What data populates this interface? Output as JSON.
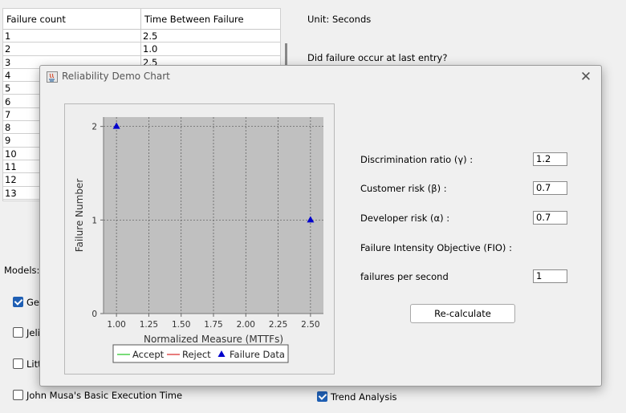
{
  "background": {
    "table": {
      "headers": [
        "Failure count",
        "Time Between Failure"
      ],
      "rows": [
        [
          "1",
          "2.5"
        ],
        [
          "2",
          "1.0"
        ],
        [
          "3",
          "2.5"
        ],
        [
          "4",
          ""
        ],
        [
          "5",
          ""
        ],
        [
          "6",
          ""
        ],
        [
          "7",
          ""
        ],
        [
          "8",
          ""
        ],
        [
          "9",
          ""
        ],
        [
          "10",
          ""
        ],
        [
          "11",
          ""
        ],
        [
          "12",
          ""
        ],
        [
          "13",
          ""
        ]
      ]
    },
    "unit_label": "Unit: Seconds",
    "question_label": "Did failure occur at last entry?",
    "models_label": "Models:",
    "models": [
      {
        "label": "Geo",
        "checked": true
      },
      {
        "label": "Jeli",
        "checked": false
      },
      {
        "label": "Litt",
        "checked": false
      },
      {
        "label": "John Musa's Basic Execution Time",
        "checked": false
      }
    ],
    "trend": {
      "label": "Trend Analysis",
      "checked": true
    }
  },
  "dialog": {
    "title": "Reliability Demo Chart",
    "close_icon": "close-icon",
    "params": {
      "disc_label": "Discrimination ratio (γ) :",
      "disc_value": "1.2",
      "cust_label": "Customer risk (β) :",
      "cust_value": "0.7",
      "dev_label": "Developer risk (α) :",
      "dev_value": "0.7",
      "fio_label": "Failure Intensity Objective (FIO) :",
      "fps_label": "failures per second",
      "fps_value": "1"
    },
    "recalc_label": "Re-calculate"
  },
  "chart_data": {
    "type": "scatter",
    "title": "",
    "xlabel": "Normalized Measure (MTTFs)",
    "ylabel": "Failure Number",
    "xlim": [
      0.9,
      2.6
    ],
    "ylim": [
      0,
      2.1
    ],
    "xticks": [
      "1.00",
      "1.25",
      "1.50",
      "1.75",
      "2.00",
      "2.25",
      "2.50"
    ],
    "yticks": [
      "0",
      "1",
      "2"
    ],
    "grid": true,
    "background": "#c0c0c0",
    "legend_position": "bottom",
    "series": [
      {
        "name": "Accept",
        "type": "line",
        "color": "#4cd04c",
        "values": []
      },
      {
        "name": "Reject",
        "type": "line",
        "color": "#e05050",
        "values": []
      },
      {
        "name": "Failure Data",
        "type": "scatter",
        "marker": "triangle",
        "color": "#0000cc",
        "points": [
          {
            "x": 1.0,
            "y": 2
          },
          {
            "x": 2.5,
            "y": 1
          }
        ]
      }
    ]
  }
}
